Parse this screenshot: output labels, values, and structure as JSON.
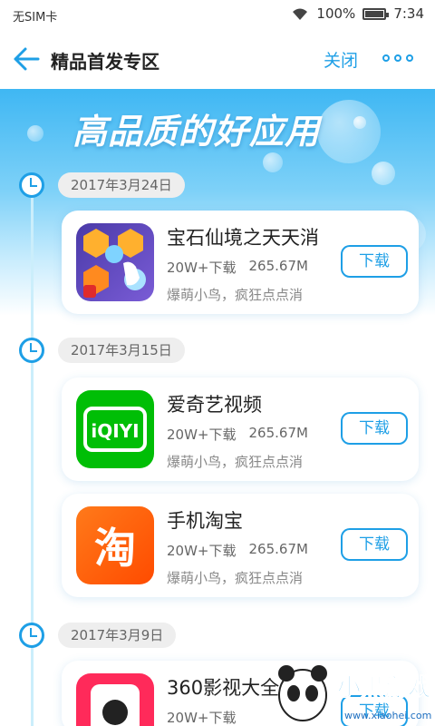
{
  "status_bar": {
    "sim": "无SIM卡",
    "battery": "100%",
    "time": "7:34",
    "battery_level": 1.0
  },
  "nav": {
    "title": "精品首发专区",
    "close": "关闭"
  },
  "banner": {
    "headline": "高品质的好应用"
  },
  "groups": [
    {
      "date": "2017年3月24日",
      "apps": [
        {
          "name": "宝石仙境之天天消",
          "downloads": "20W+下载",
          "size": "265.67M",
          "desc": "爆萌小鸟，疯狂点点消",
          "button": "下载",
          "icon": "gem-puzzle-icon"
        }
      ]
    },
    {
      "date": "2017年3月15日",
      "apps": [
        {
          "name": "爱奇艺视频",
          "downloads": "20W+下载",
          "size": "265.67M",
          "desc": "爆萌小鸟，疯狂点点消",
          "button": "下载",
          "icon": "iqiyi-icon"
        },
        {
          "name": "手机淘宝",
          "downloads": "20W+下载",
          "size": "265.67M",
          "desc": "爆萌小鸟，疯狂点点消",
          "button": "下载",
          "icon": "taobao-icon"
        }
      ]
    },
    {
      "date": "2017年3月9日",
      "apps": [
        {
          "name": "360影视大全",
          "downloads": "20W+下载",
          "size": "",
          "desc": "",
          "button": "下载",
          "icon": "360-video-icon"
        }
      ]
    }
  ],
  "icon_text": {
    "iqiyi": "iQIYI",
    "taobao": "淘"
  },
  "watermark": {
    "brand": "小黑游戏",
    "url": "www.xiaohei.com"
  },
  "colors": {
    "accent": "#1e9fe6",
    "banner_top": "#3fb7f3"
  }
}
